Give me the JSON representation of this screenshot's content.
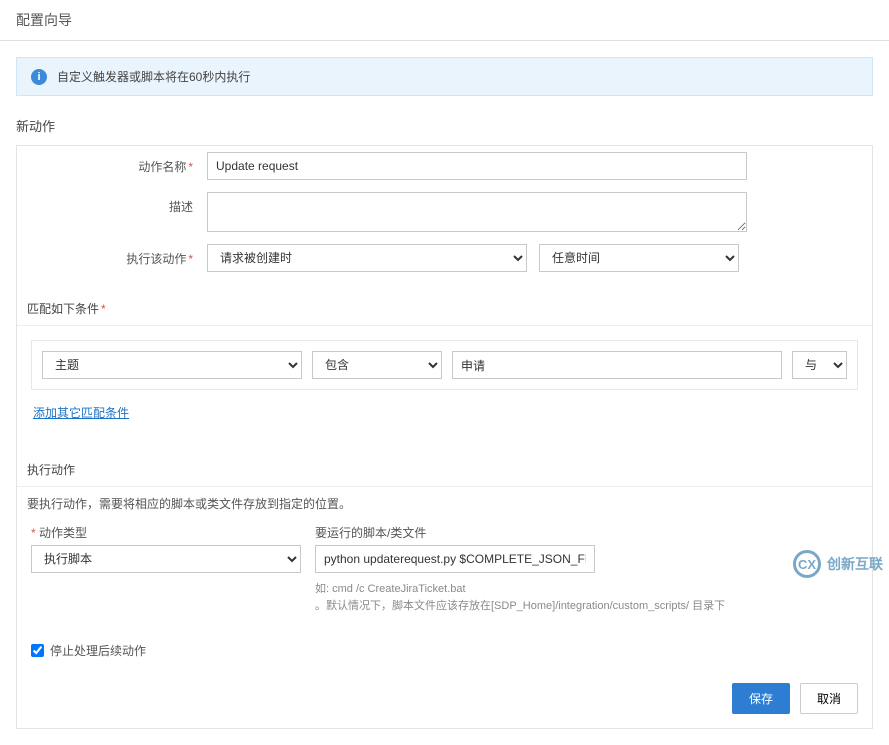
{
  "header": {
    "title": "配置向导"
  },
  "banner": {
    "text": "自定义触发器或脚本将在60秒内执行"
  },
  "section": {
    "new_action": "新动作"
  },
  "form": {
    "action_name_label": "动作名称",
    "action_name_value": "Update request",
    "description_label": "描述",
    "description_value": "",
    "trigger_label": "执行该动作",
    "trigger_value": "请求被创建时",
    "time_value": "任意时间"
  },
  "criteria": {
    "header": "匹配如下条件",
    "field": "主题",
    "operator": "包含",
    "value": "申请",
    "logic": "与",
    "add_link": "添加其它匹配条件"
  },
  "exec": {
    "header": "执行动作",
    "desc": "要执行动作，需要将相应的脚本或类文件存放到指定的位置。",
    "type_label": "动作类型",
    "type_value": "执行脚本",
    "script_label": "要运行的脚本/类文件",
    "script_value": "python updaterequest.py $COMPLETE_JSON_FILE",
    "hint1": "如: cmd /c CreateJiraTicket.bat",
    "hint2": "。默认情况下，脚本文件应该存放在[SDP_Home]/integration/custom_scripts/ 目录下"
  },
  "stop": {
    "label": "停止处理后续动作"
  },
  "buttons": {
    "save": "保存",
    "cancel": "取消"
  },
  "brand": {
    "text": "创新互联"
  }
}
